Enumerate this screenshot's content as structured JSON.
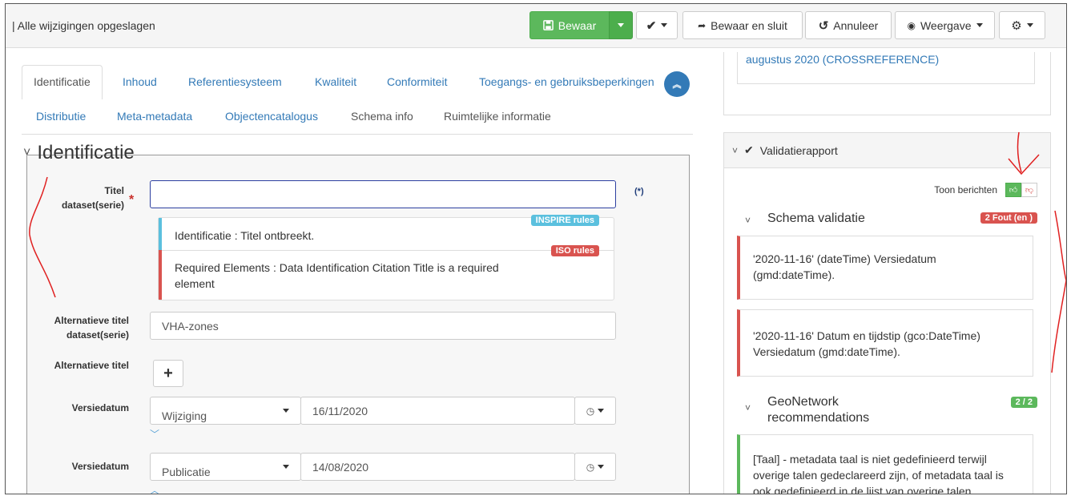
{
  "topbar": {
    "status": "| Alle wijzigingen opgeslagen",
    "save": "Bewaar",
    "save_close": "Bewaar en sluit",
    "cancel": "Annuleer",
    "view": "Weergave"
  },
  "tabs": {
    "row1": [
      "Identificatie",
      "Inhoud",
      "Referentiesysteem",
      "Kwaliteit",
      "Conformiteit",
      "Toegangs- en gebruiksbeperkingen"
    ],
    "row2": [
      "Distributie",
      "Meta-metadata",
      "Objectencatalogus",
      "Schema info",
      "Ruimtelijke informatie"
    ]
  },
  "section": {
    "title": "Identificatie"
  },
  "form": {
    "title_label_1": "Titel",
    "title_label_2": "dataset(serie)",
    "title_value": "",
    "multilingual_marker": "(*)",
    "validation": [
      {
        "text": "Identificatie : Titel ontbreekt.",
        "badge": "INSPIRE rules",
        "color": "#5bc0de"
      },
      {
        "text_1": "Required Elements : Data Identification Citation Title is a required",
        "text_2": "element",
        "badge": "ISO rules",
        "color": "#d9534f"
      }
    ],
    "alt_title_label_1": "Alternatieve titel",
    "alt_title_label_2": "dataset(serie)",
    "alt_title_value": "VHA-zones",
    "alt_title_label_single": "Alternatieve titel",
    "add_icon": "plus-icon",
    "dates": [
      {
        "label": "Versiedatum",
        "type": "Wijziging",
        "date": "16/11/2020"
      },
      {
        "label": "Versiedatum",
        "type": "Publicatie",
        "date": "14/08/2020"
      }
    ]
  },
  "right": {
    "prev_text": "augustus 2020 (CROSSREFERENCE)",
    "validation_title": "Validatierapport",
    "show_messages": "Toon berichten",
    "schema": {
      "title": "Schema validatie",
      "badge": "2 Fout (en )",
      "messages": [
        {
          "line1": "'2020-11-16' (dateTime) Versiedatum",
          "line2": "(gmd:dateTime)."
        },
        {
          "line1": "'2020-11-16' Datum en tijdstip (gco:DateTime)",
          "line2": "Versiedatum (gmd:dateTime)."
        }
      ]
    },
    "geonetwork": {
      "title_1": "GeoNetwork",
      "title_2": "recommendations",
      "badge": "2 / 2",
      "message": {
        "line1": "[Taal] - metadata taal is niet gedefinieerd terwijl",
        "line2": "overige talen gedeclareerd zijn, of metadata taal is",
        "line3": "ook gedefinieerd in de lijst van overige talen."
      }
    }
  },
  "colors": {
    "primary": "#337ab7",
    "success": "#5cb85c",
    "danger": "#d9534f",
    "info": "#5bc0de",
    "annotation": "#e02020"
  }
}
